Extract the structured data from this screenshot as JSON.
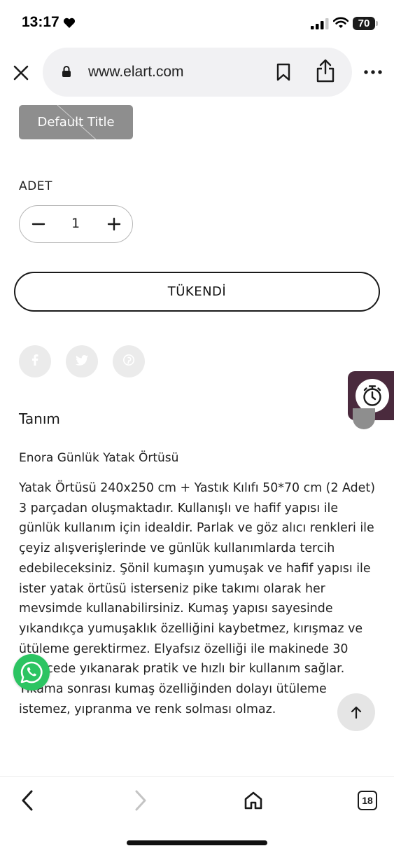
{
  "status_bar": {
    "time": "13:17",
    "battery": "70"
  },
  "browser": {
    "url": "www.elart.com",
    "tab_count": "18"
  },
  "product": {
    "variant_label": "Default Title",
    "quantity_label": "ADET",
    "quantity_value": "1",
    "sold_out_label": "TÜKENDİ",
    "social_icons": [
      "facebook-icon",
      "twitter-icon",
      "pinterest-icon"
    ]
  },
  "description": {
    "heading": "Tanım",
    "subtitle": "Enora Günlük Yatak Örtüsü",
    "body": "Yatak Örtüsü 240x250 cm + Yastık Kılıfı 50*70 cm (2 Adet) 3 parçadan oluşmaktadır. Kullanışlı ve hafif yapısı ile günlük kullanım için idealdir. Parlak ve göz alıcı renkleri ile çeyiz alışverişlerinde ve günlük kullanımlarda tercih edebileceksiniz. Şönil kumaşın yumuşak ve hafif yapısı ile ister yatak örtüsü isterseniz pike takımı olarak her mevsimde kullanabilirsiniz. Kumaş yapısı sayesinde yıkandıkça yumuşaklık özelliğini kaybetmez, kırışmaz ve ütüleme gerektirmez. Elyafsız özelliği ile makinede 30 derecede yıkanarak pratik ve hızlı bir kullanım sağlar. Yıkama sonrası kumaş özelliğinden dolayı ütüleme istemez, yıpranma ve renk solması olmaz."
  },
  "colors": {
    "accent_timer": "#4a2a3d",
    "whatsapp": "#2cc462",
    "variant_chip": "#8e8e8e"
  }
}
